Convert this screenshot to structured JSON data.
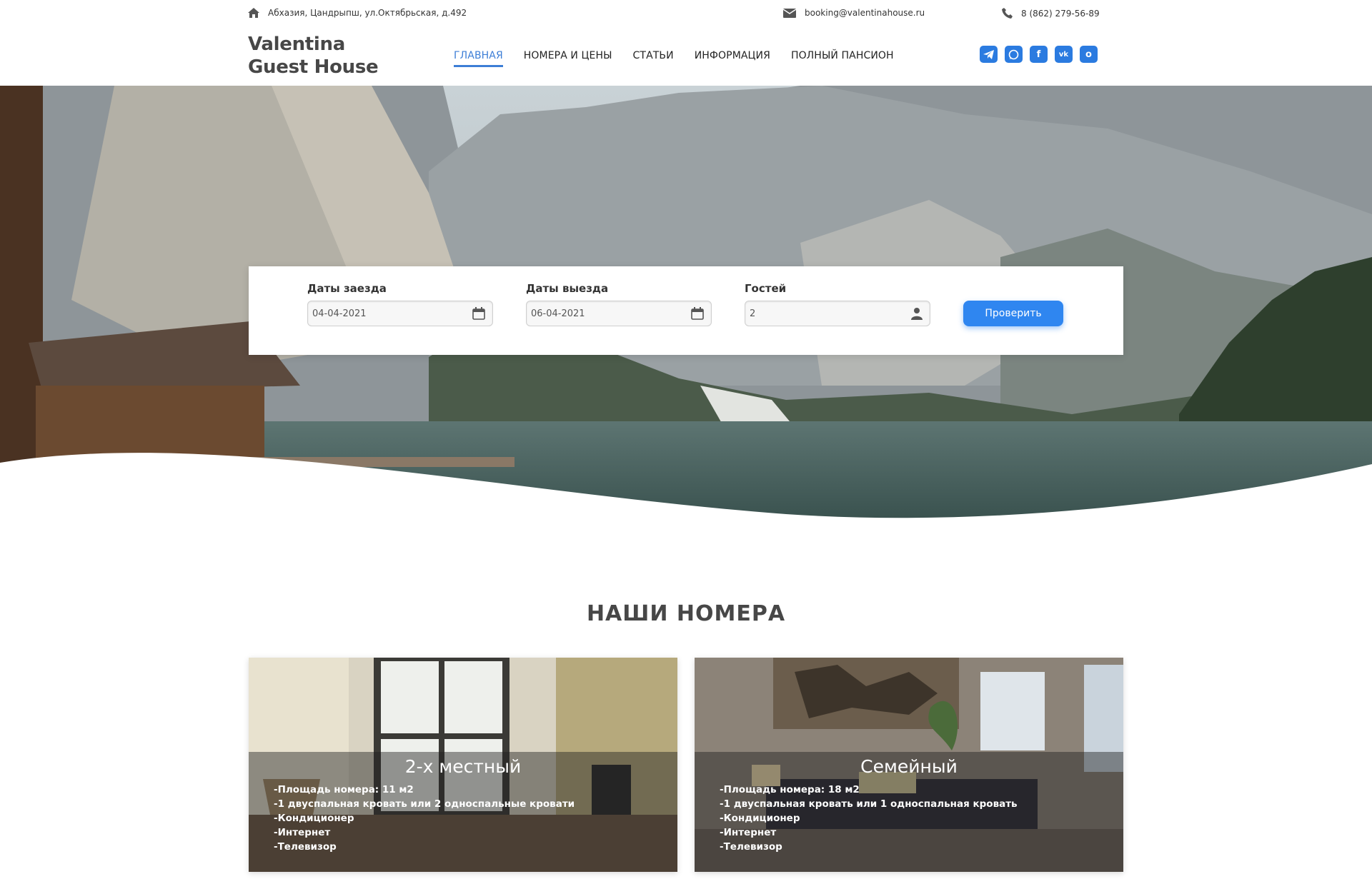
{
  "topbar": {
    "address": "Абхазия, Цандрыпш, ул.Октябрьская, д.492",
    "email": "booking@valentinahouse.ru",
    "phone": "8 (862) 279-56-89",
    "icons": [
      "home-icon",
      "mail-icon",
      "phone-icon"
    ]
  },
  "logo": {
    "line1": "Valentina",
    "line2": "Guest House"
  },
  "nav": {
    "items": [
      {
        "label": "ГЛАВНАЯ",
        "active": true
      },
      {
        "label": "НОМЕРА И ЦЕНЫ",
        "active": false
      },
      {
        "label": "СТАТЬИ",
        "active": false
      },
      {
        "label": "ИНФОРМАЦИЯ",
        "active": false
      },
      {
        "label": "ПОЛНЫЙ ПАНСИОН",
        "active": false
      }
    ]
  },
  "social": {
    "icons": [
      "telegram-icon",
      "whatsapp-icon",
      "facebook-icon",
      "vk-icon",
      "ok-icon"
    ],
    "glyphs": [
      "",
      "",
      "f",
      "vk",
      "o"
    ],
    "color": "#2b7be0"
  },
  "booking": {
    "checkin_label": "Даты заезда",
    "checkin_value": "04-04-2021",
    "checkout_label": "Даты выезда",
    "checkout_value": "06-04-2021",
    "guests_label": "Гостей",
    "guests_value": "2",
    "submit_label": "Проверить",
    "accent": "#2f86f0"
  },
  "rooms": {
    "title": "НАШИ НОМЕРА",
    "items": [
      {
        "name": "2-х местный",
        "features": [
          "-Площадь номера: 11 м2",
          "-1 двуспальная кровать или 2 односпальные кровати",
          "-Кондиционер",
          "-Интернет",
          "-Телевизор"
        ]
      },
      {
        "name": "Семейный",
        "features": [
          "-Площадь номера: 18 м2",
          "-1 двуспальная кровать или 1 односпальная кровать",
          "-Кондиционер",
          "-Интернет",
          "-Телевизор"
        ]
      }
    ]
  }
}
